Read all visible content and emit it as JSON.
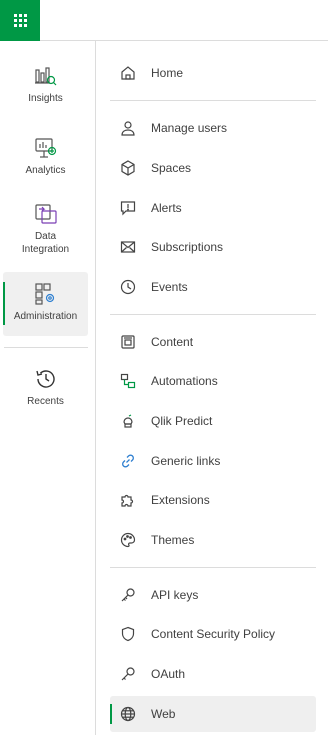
{
  "rail": {
    "items": [
      {
        "label": "Insights",
        "icon": "insights-icon"
      },
      {
        "label": "Analytics",
        "icon": "analytics-icon"
      },
      {
        "label": "Data Integration",
        "icon": "data-integration-icon"
      },
      {
        "label": "Administration",
        "icon": "administration-icon",
        "active": true
      },
      {
        "label": "Recents",
        "icon": "recents-icon"
      }
    ]
  },
  "menu": {
    "items": [
      {
        "label": "Home",
        "icon": "home-icon"
      },
      {
        "label": "Manage users",
        "icon": "user-icon"
      },
      {
        "label": "Spaces",
        "icon": "cube-icon"
      },
      {
        "label": "Alerts",
        "icon": "alert-icon"
      },
      {
        "label": "Subscriptions",
        "icon": "envelope-icon"
      },
      {
        "label": "Events",
        "icon": "clock-icon"
      },
      {
        "label": "Content",
        "icon": "content-icon"
      },
      {
        "label": "Automations",
        "icon": "automation-icon"
      },
      {
        "label": "Qlik Predict",
        "icon": "predict-icon"
      },
      {
        "label": "Generic links",
        "icon": "link-icon"
      },
      {
        "label": "Extensions",
        "icon": "puzzle-icon"
      },
      {
        "label": "Themes",
        "icon": "palette-icon"
      },
      {
        "label": "API keys",
        "icon": "key-icon"
      },
      {
        "label": "Content Security Policy",
        "icon": "shield-icon"
      },
      {
        "label": "OAuth",
        "icon": "oauth-key-icon"
      },
      {
        "label": "Web",
        "icon": "globe-icon",
        "active": true
      }
    ]
  },
  "colors": {
    "accent": "#009845",
    "text": "#404040",
    "divider": "#dcdcdc",
    "active_bg": "#efefef"
  }
}
